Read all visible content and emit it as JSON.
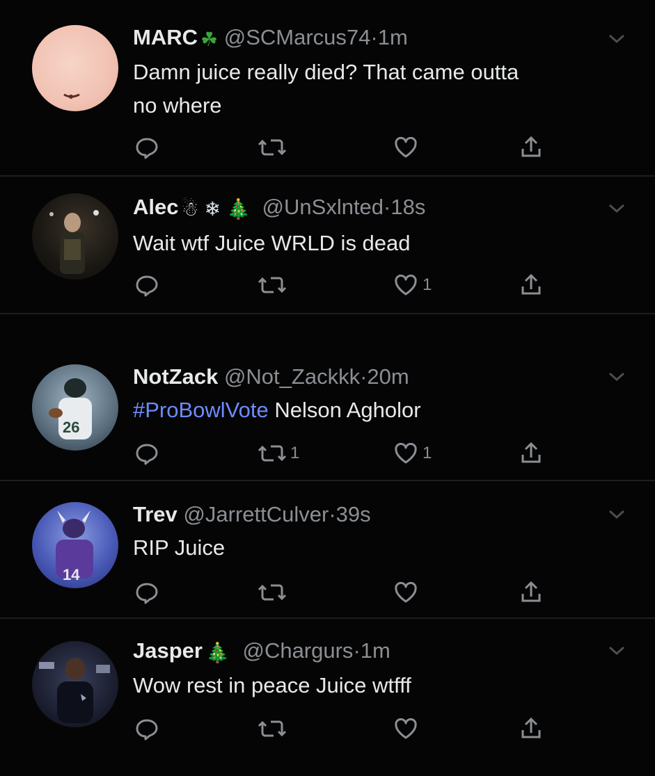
{
  "colors": {
    "background": "#050505",
    "text": "#e7e9ea",
    "muted": "#8b8f94",
    "hashtag": "#6b8cff",
    "divider": "#1e1e1e"
  },
  "tweets": [
    {
      "name": "MARC",
      "name_emoji": "☘",
      "handle": "@SCMarcus74",
      "dot": "·",
      "time": "1m",
      "text_line1": "Damn juice really died? That came outta",
      "text_line2": "no where",
      "retweets": "",
      "likes": ""
    },
    {
      "name": "Alec",
      "name_emoji": "☃❄🎄",
      "handle": "@UnSxlnted",
      "dot": "·",
      "time": "18s",
      "text_line1": "Wait wtf Juice WRLD is dead",
      "retweets": "",
      "likes": "1"
    },
    {
      "name": "NotZack",
      "handle": "@Not_Zackkk",
      "dot": "·",
      "time": "20m",
      "hashtag": "#ProBowlVote",
      "text_rest": " Nelson Agholor",
      "retweets": "1",
      "likes": "1"
    },
    {
      "name": "Trev",
      "handle": "@JarrettCulver",
      "dot": "·",
      "time": "39s",
      "text_line1": "RIP Juice",
      "retweets": "",
      "likes": ""
    },
    {
      "name": "Jasper",
      "name_emoji": "🎄",
      "handle": "@Chargurs",
      "dot": "·",
      "time": "1m",
      "text_line1": "Wow rest in peace Juice wtfff",
      "retweets": "",
      "likes": ""
    }
  ],
  "icons": {
    "reply": "reply-icon",
    "retweet": "retweet-icon",
    "like": "heart-icon",
    "share": "share-icon",
    "menu": "chevron-down-icon"
  }
}
